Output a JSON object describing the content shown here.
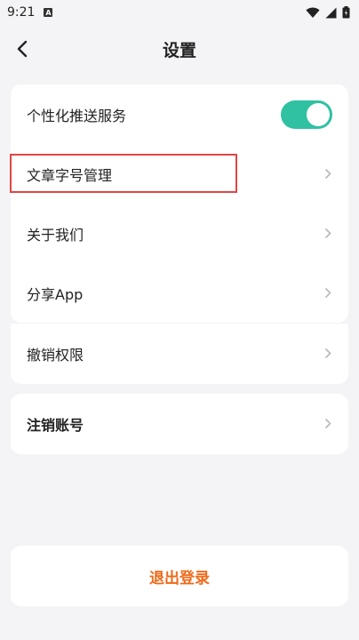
{
  "status_bar": {
    "time": "9:21",
    "notif_icon": "A"
  },
  "nav": {
    "title": "设置"
  },
  "settings": {
    "push_service": {
      "label": "个性化推送服务",
      "enabled": true,
      "toggle_color": "#2fc1a2"
    },
    "font_management": {
      "label": "文章字号管理"
    },
    "about_us": {
      "label": "关于我们"
    },
    "share_app": {
      "label": "分享App"
    },
    "revoke_permissions": {
      "label": "撤销权限"
    },
    "cancel_account": {
      "label": "注销账号"
    }
  },
  "logout": {
    "label": "退出登录",
    "color": "#ef6a1a"
  },
  "highlight_color": "#e04545"
}
